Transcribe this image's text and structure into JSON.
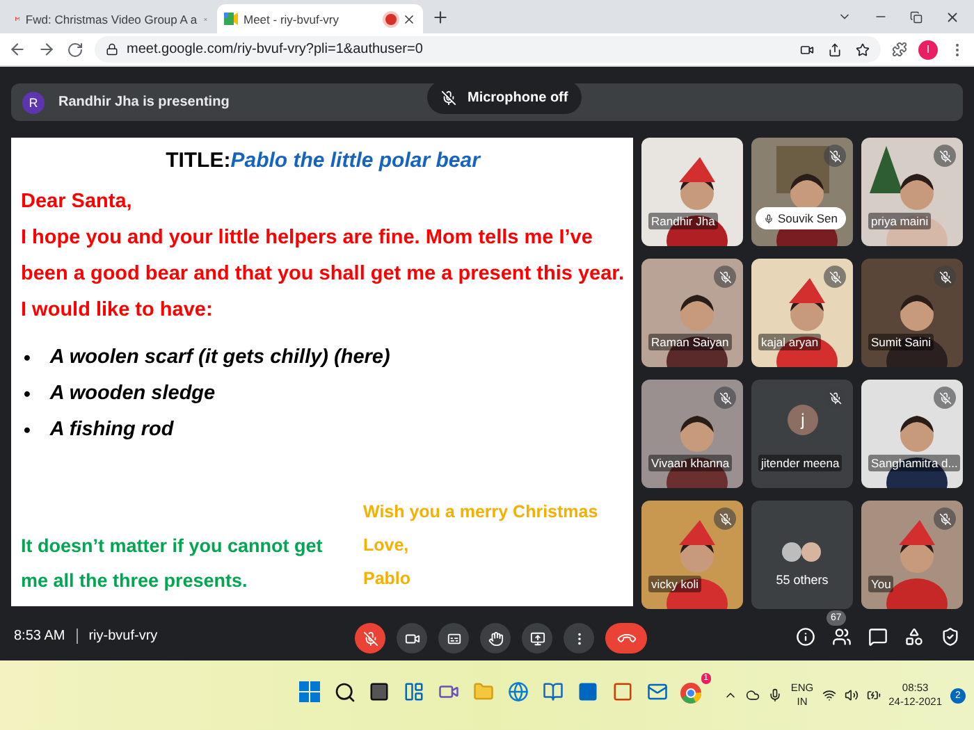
{
  "browser": {
    "tabs": [
      {
        "title": "Fwd: Christmas Video Group A a",
        "selected": false,
        "recording": false
      },
      {
        "title": "Meet - riy-bvuf-vry",
        "selected": true,
        "recording": true
      }
    ],
    "url": "meet.google.com/riy-bvuf-vry?pli=1&authuser=0",
    "profile_initial": "I"
  },
  "banner": {
    "initial": "R",
    "text": "Randhir Jha is presenting"
  },
  "toast": "Microphone off",
  "slide": {
    "title_label": "TITLE:",
    "title": "Pablo the little polar bear",
    "greeting": "Dear Santa,",
    "body": "I hope you and your little helpers are fine. Mom tells me I’ve been a good bear and that you shall get me a present this year. I would like to have:",
    "items": [
      {
        "bullet": "•",
        "text": "A woolen scarf (it gets chilly) (here)"
      },
      {
        "bullet": "•",
        "text": "A wooden sledge"
      },
      {
        "bullet": "•",
        "text": "A fishing rod"
      }
    ],
    "closing": "It doesn’t matter if you cannot get me all the three presents.",
    "signoff": [
      "Wish you a merry Christmas",
      "Love,",
      "Pablo"
    ]
  },
  "tiles": [
    {
      "kind": "video",
      "name": "Randhir Jha",
      "muted": false,
      "pinned": false
    },
    {
      "kind": "video",
      "name": "Souvik Sen",
      "muted": true,
      "pinned": true
    },
    {
      "kind": "video",
      "name": "priya maini",
      "muted": true,
      "pinned": false
    },
    {
      "kind": "video",
      "name": "Raman Saiyan",
      "muted": true,
      "pinned": false
    },
    {
      "kind": "video",
      "name": "kajal aryan",
      "muted": true,
      "pinned": false
    },
    {
      "kind": "video",
      "name": "Sumit Saini",
      "muted": true,
      "pinned": false
    },
    {
      "kind": "video",
      "name": "Vivaan khanna",
      "muted": true,
      "pinned": false
    },
    {
      "kind": "avatar",
      "name": "jitender meena",
      "initial": "j",
      "muted": true,
      "pinned": false
    },
    {
      "kind": "video",
      "name": "Sanghamitra d...",
      "muted": true,
      "pinned": false
    },
    {
      "kind": "video",
      "name": "vicky koli",
      "muted": true,
      "pinned": false
    },
    {
      "kind": "others",
      "name": "55 others"
    },
    {
      "kind": "video",
      "name": "You",
      "muted": true,
      "pinned": false
    }
  ],
  "meeting": {
    "time": "8:53 AM",
    "code": "riy-bvuf-vry",
    "participants": "67"
  },
  "controls": [
    {
      "kind": "mic",
      "on": false
    },
    {
      "kind": "camera",
      "on": true
    },
    {
      "kind": "captions",
      "on": true
    },
    {
      "kind": "hand",
      "on": true
    },
    {
      "kind": "present",
      "on": true
    },
    {
      "kind": "more",
      "on": true
    },
    {
      "kind": "leave"
    }
  ],
  "taskbar": {
    "chrome_badge": "1",
    "language": "ENG",
    "region": "IN",
    "time": "08:53",
    "date": "24-12-2021",
    "notifications": "2"
  }
}
